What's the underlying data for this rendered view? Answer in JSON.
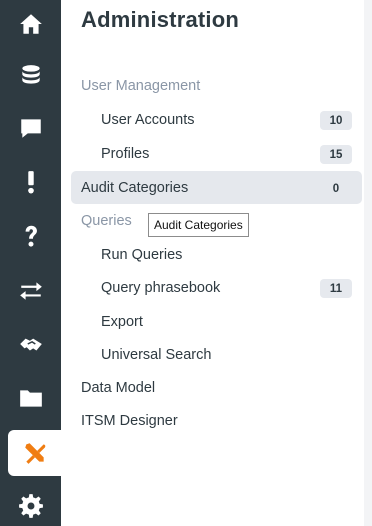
{
  "sidebar": {
    "icons": [
      {
        "name": "home-icon",
        "active": false
      },
      {
        "name": "database-icon",
        "active": false
      },
      {
        "name": "chat-icon",
        "active": false
      },
      {
        "name": "exclamation-icon",
        "active": false
      },
      {
        "name": "question-icon",
        "active": false
      },
      {
        "name": "transfer-arrows-icon",
        "active": false
      },
      {
        "name": "handshake-icon",
        "active": false
      },
      {
        "name": "folder-icon",
        "active": false
      },
      {
        "name": "tools-icon",
        "active": true
      },
      {
        "name": "gear-icon",
        "active": false
      }
    ],
    "icon_color": "#ffffff",
    "active_icon_color": "#f07d12",
    "background": "#2e3a41"
  },
  "panel": {
    "title": "Administration",
    "menu": [
      {
        "label": "User Management",
        "kind": "section",
        "badge": null
      },
      {
        "label": "User Accounts",
        "kind": "sub",
        "badge": "10"
      },
      {
        "label": "Profiles",
        "kind": "sub",
        "badge": "15"
      },
      {
        "label": "Audit Categories",
        "kind": "item",
        "badge": "0",
        "selected": true
      },
      {
        "label": "Queries",
        "kind": "section",
        "badge": null
      },
      {
        "label": "Run Queries",
        "kind": "sub",
        "badge": null
      },
      {
        "label": "Query phrasebook",
        "kind": "sub",
        "badge": "11"
      },
      {
        "label": "Export",
        "kind": "sub",
        "badge": null
      },
      {
        "label": "Universal Search",
        "kind": "sub",
        "badge": null
      },
      {
        "label": "Data Model",
        "kind": "item",
        "badge": null
      },
      {
        "label": "ITSM Designer",
        "kind": "item",
        "badge": null
      }
    ]
  },
  "tooltip": {
    "text": "Audit Categories"
  }
}
